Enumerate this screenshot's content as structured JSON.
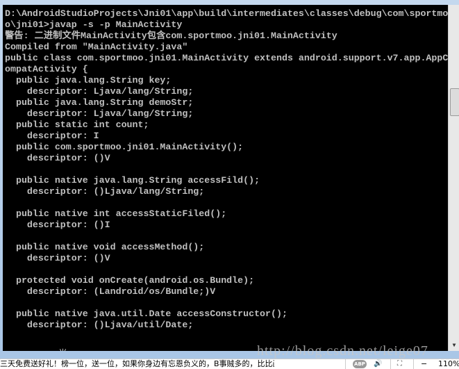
{
  "console": {
    "lines": [
      "D:\\AndroidStudioProjects\\Jni01\\app\\build\\intermediates\\classes\\debug\\com\\sportmo",
      "o\\jni01>javap -s -p MainActivity",
      "警告: 二进制文件MainActivity包含com.sportmoo.jni01.MainActivity",
      "Compiled from \"MainActivity.java\"",
      "public class com.sportmoo.jni01.MainActivity extends android.support.v7.app.AppC",
      "ompatActivity {",
      "  public java.lang.String key;",
      "    descriptor: Ljava/lang/String;",
      "  public java.lang.String demoStr;",
      "    descriptor: Ljava/lang/String;",
      "  public static int count;",
      "    descriptor: I",
      "  public com.sportmoo.jni01.MainActivity();",
      "    descriptor: ()V",
      "",
      "  public native java.lang.String accessFild();",
      "    descriptor: ()Ljava/lang/String;",
      "",
      "  public native int accessStaticFiled();",
      "    descriptor: ()I",
      "",
      "  public native void accessMethod();",
      "    descriptor: ()V",
      "",
      "  protected void onCreate(android.os.Bundle);",
      "    descriptor: (Landroid/os/Bundle;)V",
      "",
      "  public native java.util.Date accessConstructor();",
      "    descriptor: ()Ljava/util/Date;"
    ],
    "ime_prompt": "半:"
  },
  "watermark": "http://blog.csdn.net/leige07",
  "statusbar": {
    "text": "三天免费送好礼！榜一位，送一位，如果你身边有忘恩负义的，B事贼多的，比比画画的，...",
    "abp_label": "ABP",
    "zoom_minus": "−",
    "zoom_level": "110%"
  }
}
